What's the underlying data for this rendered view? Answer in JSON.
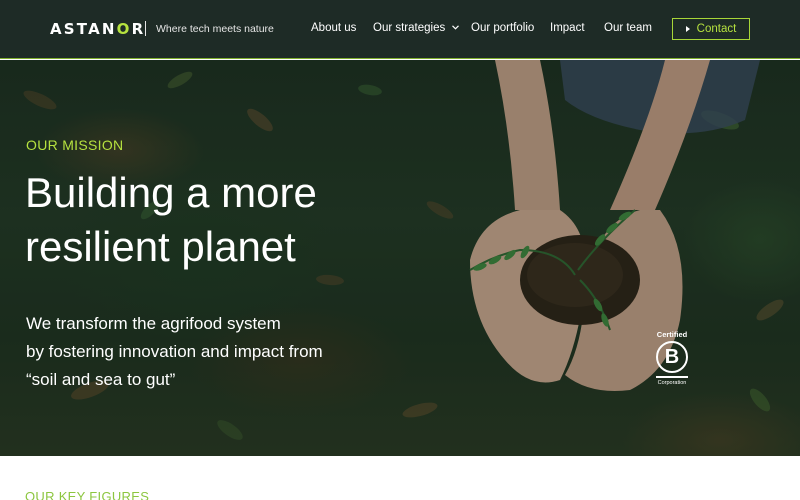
{
  "brand": {
    "name_part1": "AST",
    "name_accent": "A",
    "name_part2": "N",
    "name_o": "O",
    "name_part3": "R",
    "tagline": "Where tech meets nature",
    "colors": {
      "header_bg": "#1e2b26",
      "accent": "#b6e23f",
      "key_figures": "#8cc63f"
    }
  },
  "nav": {
    "items": [
      {
        "label": "About us"
      },
      {
        "label": "Our strategies",
        "icon": "chevron-down-icon"
      },
      {
        "label": "Our portfolio"
      },
      {
        "label": "Impact"
      },
      {
        "label": "Our team"
      }
    ],
    "contact_label": "Contact",
    "contact_icon": "play-triangle-icon"
  },
  "hero": {
    "eyebrow": "OUR MISSION",
    "title_line1": "Building a more",
    "title_line2": "resilient planet",
    "sub_line1": "We transform the agrifood system",
    "sub_line2": "by fostering innovation and impact from",
    "sub_line3": "“soil and sea to gut”",
    "image_subject": "hands holding soil with a seedling",
    "badge": {
      "top": "Certified",
      "letter": "B",
      "bottom": "Corporation"
    }
  },
  "section": {
    "key_figures_label": "OUR KEY FIGURES"
  }
}
